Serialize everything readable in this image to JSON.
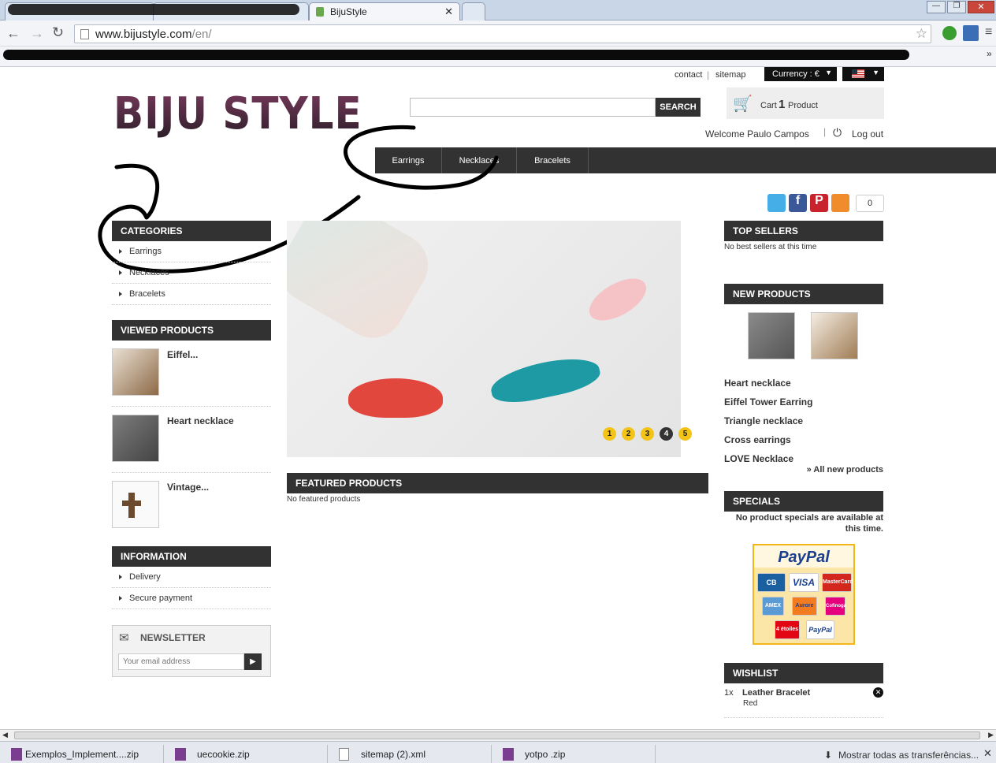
{
  "browser": {
    "active_tab_title": "BijuStyle",
    "url_domain": "www.bijustyle.com",
    "url_path": "/en/"
  },
  "top_links": {
    "contact": "contact",
    "sitemap": "sitemap",
    "currency": "Currency : €"
  },
  "logo_text": "BIJU STYLE",
  "search": {
    "button": "SEARCH",
    "placeholder": ""
  },
  "cart": {
    "label": "Cart",
    "count": "1",
    "unit": "Product"
  },
  "user": {
    "welcome": "Welcome Paulo Campos",
    "logout": "Log out"
  },
  "nav": [
    "Earrings",
    "Necklaces",
    "Bracelets"
  ],
  "social": {
    "count": "0"
  },
  "categories": {
    "title": "CATEGORIES",
    "items": [
      "Earrings",
      "Necklaces",
      "Bracelets"
    ]
  },
  "viewed": {
    "title": "VIEWED PRODUCTS",
    "items": [
      "Eiffel...",
      "Heart necklace",
      "Vintage..."
    ]
  },
  "information": {
    "title": "INFORMATION",
    "items": [
      "Delivery",
      "Secure payment"
    ]
  },
  "newsletter": {
    "title": "NEWSLETTER",
    "placeholder": "Your email address"
  },
  "slider": {
    "pages": [
      "1",
      "2",
      "3",
      "4",
      "5"
    ],
    "active": "4"
  },
  "featured": {
    "title": "FEATURED PRODUCTS",
    "empty": "No featured products"
  },
  "top_sellers": {
    "title": "TOP SELLERS",
    "empty": "No best sellers at this time"
  },
  "new_products": {
    "title": "NEW PRODUCTS",
    "items": [
      "Heart necklace",
      "Eiffel Tower Earring",
      "Triangle necklace",
      "Cross earrings",
      "LOVE Necklace"
    ],
    "all_link": "» All new products"
  },
  "specials": {
    "title": "SPECIALS",
    "empty": "No product specials are available at this time."
  },
  "paypal": {
    "title": "PayPal",
    "cards": [
      "CB",
      "VISA",
      "MasterCard",
      "AMEX",
      "Aurore",
      "Cofinoga",
      "4 étoiles",
      "PayPal"
    ]
  },
  "wishlist": {
    "title": "WISHLIST",
    "qty": "1x",
    "item": "Leather Bracelet",
    "variant": "Red"
  },
  "downloads": [
    "Exemplos_Implement....zip",
    "uecookie.zip",
    "sitemap (2).xml",
    "yotpo .zip"
  ],
  "downloads_show_all": "Mostrar todas as transferências..."
}
